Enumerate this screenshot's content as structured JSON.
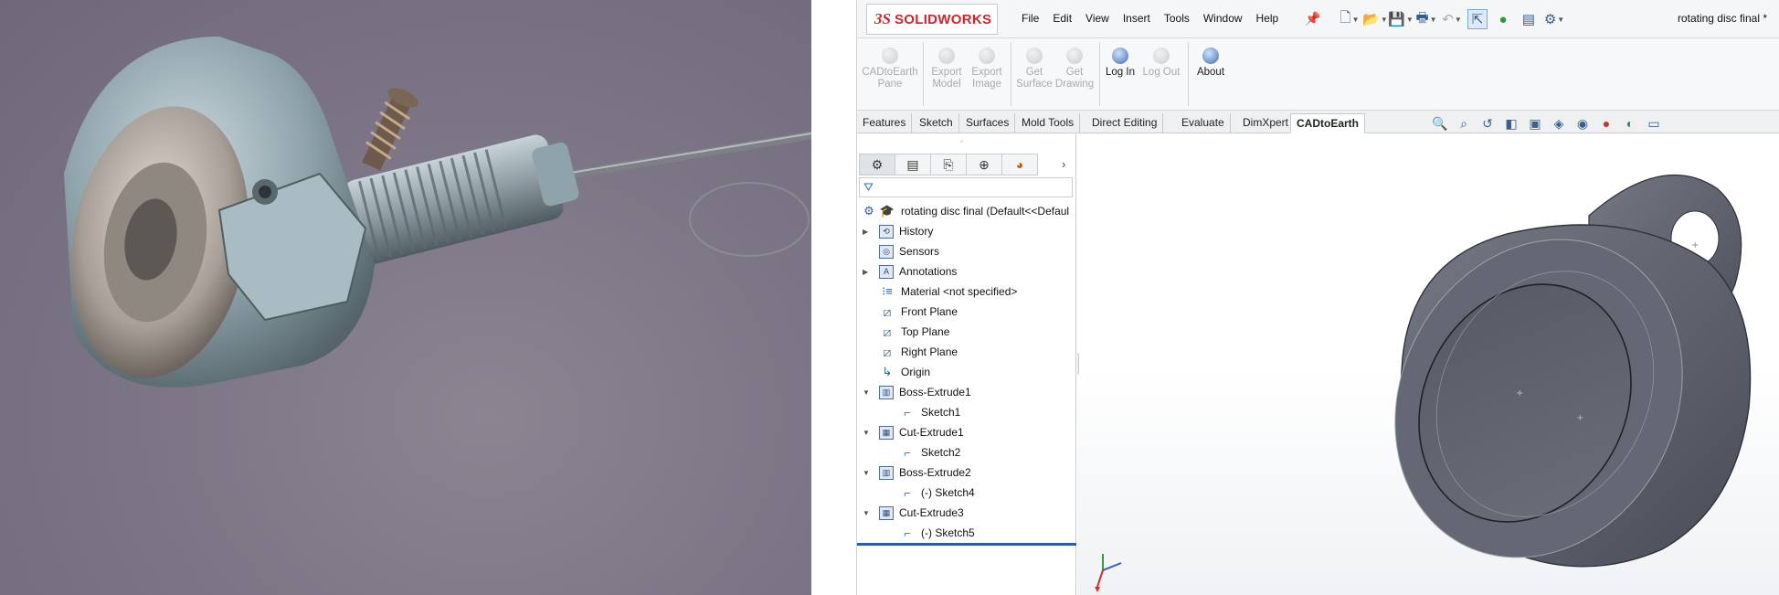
{
  "app": {
    "logo_prefix": "3S",
    "logo_word": "SOLIDWORKS",
    "document_title": "rotating disc final *"
  },
  "menu": [
    "File",
    "Edit",
    "View",
    "Insert",
    "Tools",
    "Window",
    "Help"
  ],
  "ribbon": {
    "buttons": [
      {
        "label": "CADtoEarth Pane",
        "enabled": false
      },
      {
        "label": "Export Model",
        "enabled": false
      },
      {
        "label": "Export Image",
        "enabled": false
      },
      {
        "label": "Get Surface",
        "enabled": false
      },
      {
        "label": "Get Drawing",
        "enabled": false
      },
      {
        "label": "Log In",
        "enabled": true
      },
      {
        "label": "Log Out",
        "enabled": false
      },
      {
        "label": "About",
        "enabled": true
      }
    ]
  },
  "tabs": [
    "Features",
    "Sketch",
    "Surfaces",
    "Mold Tools",
    "Direct Editing",
    "Evaluate",
    "DimXpert",
    "CADtoEarth"
  ],
  "active_tab": "CADtoEarth",
  "feature_tree": {
    "root": "rotating disc final  (Default<<Defaul",
    "items": [
      {
        "label": "History",
        "icon": "history-icon",
        "expander": "collapsed",
        "level": 0
      },
      {
        "label": "Sensors",
        "icon": "sensors-icon",
        "expander": "none",
        "level": 0
      },
      {
        "label": "Annotations",
        "icon": "annotations-icon",
        "expander": "collapsed",
        "level": 0
      },
      {
        "label": "Material <not specified>",
        "icon": "material-icon",
        "expander": "none",
        "level": 0
      },
      {
        "label": "Front Plane",
        "icon": "plane-icon",
        "expander": "none",
        "level": 0
      },
      {
        "label": "Top Plane",
        "icon": "plane-icon",
        "expander": "none",
        "level": 0
      },
      {
        "label": "Right Plane",
        "icon": "plane-icon",
        "expander": "none",
        "level": 0
      },
      {
        "label": "Origin",
        "icon": "origin-icon",
        "expander": "none",
        "level": 0
      },
      {
        "label": "Boss-Extrude1",
        "icon": "extrude-icon",
        "expander": "expanded",
        "level": 0
      },
      {
        "label": "Sketch1",
        "icon": "sketch-icon",
        "expander": "none",
        "level": 1
      },
      {
        "label": "Cut-Extrude1",
        "icon": "cut-extrude-icon",
        "expander": "expanded",
        "level": 0
      },
      {
        "label": "Sketch2",
        "icon": "sketch-icon",
        "expander": "none",
        "level": 1
      },
      {
        "label": "Boss-Extrude2",
        "icon": "extrude-icon",
        "expander": "expanded",
        "level": 0
      },
      {
        "label": "(-) Sketch4",
        "icon": "sketch-icon",
        "expander": "none",
        "level": 1
      },
      {
        "label": "Cut-Extrude3",
        "icon": "cut-extrude-icon",
        "expander": "expanded",
        "level": 0
      },
      {
        "label": "(-) Sketch5",
        "icon": "sketch-icon",
        "expander": "none",
        "level": 1
      }
    ]
  },
  "colors": {
    "brand": "#d2232a",
    "selection": "#2a5ea8",
    "model": "#5f636e"
  },
  "photo": {
    "subject": "photograph of a mechanical rotating disc part with threaded shaft and cable"
  }
}
